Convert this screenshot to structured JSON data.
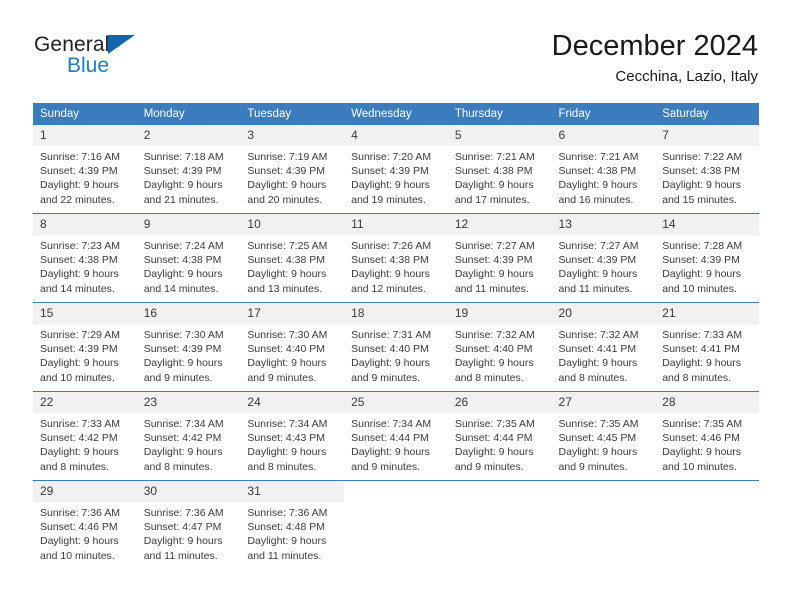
{
  "brand": {
    "name_part1": "General",
    "name_part2": "Blue",
    "logo_icon": "blue-triangle-logo-icon",
    "accent_color": "#1f7cc0",
    "mark_color": "#1566a8"
  },
  "header": {
    "title": "December 2024",
    "subtitle": "Cecchina, Lazio, Italy"
  },
  "theme": {
    "header_row_bg": "#3a7cbe",
    "header_row_text": "#ffffff",
    "daynum_bg": "#f1f1f1",
    "cell_text": "#3a3a3a",
    "row_divider": "#3a7cbe"
  },
  "weekday_headers": [
    "Sunday",
    "Monday",
    "Tuesday",
    "Wednesday",
    "Thursday",
    "Friday",
    "Saturday"
  ],
  "weeks": [
    [
      {
        "day": "1",
        "sunrise": "Sunrise: 7:16 AM",
        "sunset": "Sunset: 4:39 PM",
        "daylight_line1": "Daylight: 9 hours",
        "daylight_line2": "and 22 minutes."
      },
      {
        "day": "2",
        "sunrise": "Sunrise: 7:18 AM",
        "sunset": "Sunset: 4:39 PM",
        "daylight_line1": "Daylight: 9 hours",
        "daylight_line2": "and 21 minutes."
      },
      {
        "day": "3",
        "sunrise": "Sunrise: 7:19 AM",
        "sunset": "Sunset: 4:39 PM",
        "daylight_line1": "Daylight: 9 hours",
        "daylight_line2": "and 20 minutes."
      },
      {
        "day": "4",
        "sunrise": "Sunrise: 7:20 AM",
        "sunset": "Sunset: 4:39 PM",
        "daylight_line1": "Daylight: 9 hours",
        "daylight_line2": "and 19 minutes."
      },
      {
        "day": "5",
        "sunrise": "Sunrise: 7:21 AM",
        "sunset": "Sunset: 4:38 PM",
        "daylight_line1": "Daylight: 9 hours",
        "daylight_line2": "and 17 minutes."
      },
      {
        "day": "6",
        "sunrise": "Sunrise: 7:21 AM",
        "sunset": "Sunset: 4:38 PM",
        "daylight_line1": "Daylight: 9 hours",
        "daylight_line2": "and 16 minutes."
      },
      {
        "day": "7",
        "sunrise": "Sunrise: 7:22 AM",
        "sunset": "Sunset: 4:38 PM",
        "daylight_line1": "Daylight: 9 hours",
        "daylight_line2": "and 15 minutes."
      }
    ],
    [
      {
        "day": "8",
        "sunrise": "Sunrise: 7:23 AM",
        "sunset": "Sunset: 4:38 PM",
        "daylight_line1": "Daylight: 9 hours",
        "daylight_line2": "and 14 minutes."
      },
      {
        "day": "9",
        "sunrise": "Sunrise: 7:24 AM",
        "sunset": "Sunset: 4:38 PM",
        "daylight_line1": "Daylight: 9 hours",
        "daylight_line2": "and 14 minutes."
      },
      {
        "day": "10",
        "sunrise": "Sunrise: 7:25 AM",
        "sunset": "Sunset: 4:38 PM",
        "daylight_line1": "Daylight: 9 hours",
        "daylight_line2": "and 13 minutes."
      },
      {
        "day": "11",
        "sunrise": "Sunrise: 7:26 AM",
        "sunset": "Sunset: 4:38 PM",
        "daylight_line1": "Daylight: 9 hours",
        "daylight_line2": "and 12 minutes."
      },
      {
        "day": "12",
        "sunrise": "Sunrise: 7:27 AM",
        "sunset": "Sunset: 4:39 PM",
        "daylight_line1": "Daylight: 9 hours",
        "daylight_line2": "and 11 minutes."
      },
      {
        "day": "13",
        "sunrise": "Sunrise: 7:27 AM",
        "sunset": "Sunset: 4:39 PM",
        "daylight_line1": "Daylight: 9 hours",
        "daylight_line2": "and 11 minutes."
      },
      {
        "day": "14",
        "sunrise": "Sunrise: 7:28 AM",
        "sunset": "Sunset: 4:39 PM",
        "daylight_line1": "Daylight: 9 hours",
        "daylight_line2": "and 10 minutes."
      }
    ],
    [
      {
        "day": "15",
        "sunrise": "Sunrise: 7:29 AM",
        "sunset": "Sunset: 4:39 PM",
        "daylight_line1": "Daylight: 9 hours",
        "daylight_line2": "and 10 minutes."
      },
      {
        "day": "16",
        "sunrise": "Sunrise: 7:30 AM",
        "sunset": "Sunset: 4:39 PM",
        "daylight_line1": "Daylight: 9 hours",
        "daylight_line2": "and 9 minutes."
      },
      {
        "day": "17",
        "sunrise": "Sunrise: 7:30 AM",
        "sunset": "Sunset: 4:40 PM",
        "daylight_line1": "Daylight: 9 hours",
        "daylight_line2": "and 9 minutes."
      },
      {
        "day": "18",
        "sunrise": "Sunrise: 7:31 AM",
        "sunset": "Sunset: 4:40 PM",
        "daylight_line1": "Daylight: 9 hours",
        "daylight_line2": "and 9 minutes."
      },
      {
        "day": "19",
        "sunrise": "Sunrise: 7:32 AM",
        "sunset": "Sunset: 4:40 PM",
        "daylight_line1": "Daylight: 9 hours",
        "daylight_line2": "and 8 minutes."
      },
      {
        "day": "20",
        "sunrise": "Sunrise: 7:32 AM",
        "sunset": "Sunset: 4:41 PM",
        "daylight_line1": "Daylight: 9 hours",
        "daylight_line2": "and 8 minutes."
      },
      {
        "day": "21",
        "sunrise": "Sunrise: 7:33 AM",
        "sunset": "Sunset: 4:41 PM",
        "daylight_line1": "Daylight: 9 hours",
        "daylight_line2": "and 8 minutes."
      }
    ],
    [
      {
        "day": "22",
        "sunrise": "Sunrise: 7:33 AM",
        "sunset": "Sunset: 4:42 PM",
        "daylight_line1": "Daylight: 9 hours",
        "daylight_line2": "and 8 minutes."
      },
      {
        "day": "23",
        "sunrise": "Sunrise: 7:34 AM",
        "sunset": "Sunset: 4:42 PM",
        "daylight_line1": "Daylight: 9 hours",
        "daylight_line2": "and 8 minutes."
      },
      {
        "day": "24",
        "sunrise": "Sunrise: 7:34 AM",
        "sunset": "Sunset: 4:43 PM",
        "daylight_line1": "Daylight: 9 hours",
        "daylight_line2": "and 8 minutes."
      },
      {
        "day": "25",
        "sunrise": "Sunrise: 7:34 AM",
        "sunset": "Sunset: 4:44 PM",
        "daylight_line1": "Daylight: 9 hours",
        "daylight_line2": "and 9 minutes."
      },
      {
        "day": "26",
        "sunrise": "Sunrise: 7:35 AM",
        "sunset": "Sunset: 4:44 PM",
        "daylight_line1": "Daylight: 9 hours",
        "daylight_line2": "and 9 minutes."
      },
      {
        "day": "27",
        "sunrise": "Sunrise: 7:35 AM",
        "sunset": "Sunset: 4:45 PM",
        "daylight_line1": "Daylight: 9 hours",
        "daylight_line2": "and 9 minutes."
      },
      {
        "day": "28",
        "sunrise": "Sunrise: 7:35 AM",
        "sunset": "Sunset: 4:46 PM",
        "daylight_line1": "Daylight: 9 hours",
        "daylight_line2": "and 10 minutes."
      }
    ],
    [
      {
        "day": "29",
        "sunrise": "Sunrise: 7:36 AM",
        "sunset": "Sunset: 4:46 PM",
        "daylight_line1": "Daylight: 9 hours",
        "daylight_line2": "and 10 minutes."
      },
      {
        "day": "30",
        "sunrise": "Sunrise: 7:36 AM",
        "sunset": "Sunset: 4:47 PM",
        "daylight_line1": "Daylight: 9 hours",
        "daylight_line2": "and 11 minutes."
      },
      {
        "day": "31",
        "sunrise": "Sunrise: 7:36 AM",
        "sunset": "Sunset: 4:48 PM",
        "daylight_line1": "Daylight: 9 hours",
        "daylight_line2": "and 11 minutes."
      },
      {
        "day": "",
        "sunrise": "",
        "sunset": "",
        "daylight_line1": "",
        "daylight_line2": ""
      },
      {
        "day": "",
        "sunrise": "",
        "sunset": "",
        "daylight_line1": "",
        "daylight_line2": ""
      },
      {
        "day": "",
        "sunrise": "",
        "sunset": "",
        "daylight_line1": "",
        "daylight_line2": ""
      },
      {
        "day": "",
        "sunrise": "",
        "sunset": "",
        "daylight_line1": "",
        "daylight_line2": ""
      }
    ]
  ]
}
